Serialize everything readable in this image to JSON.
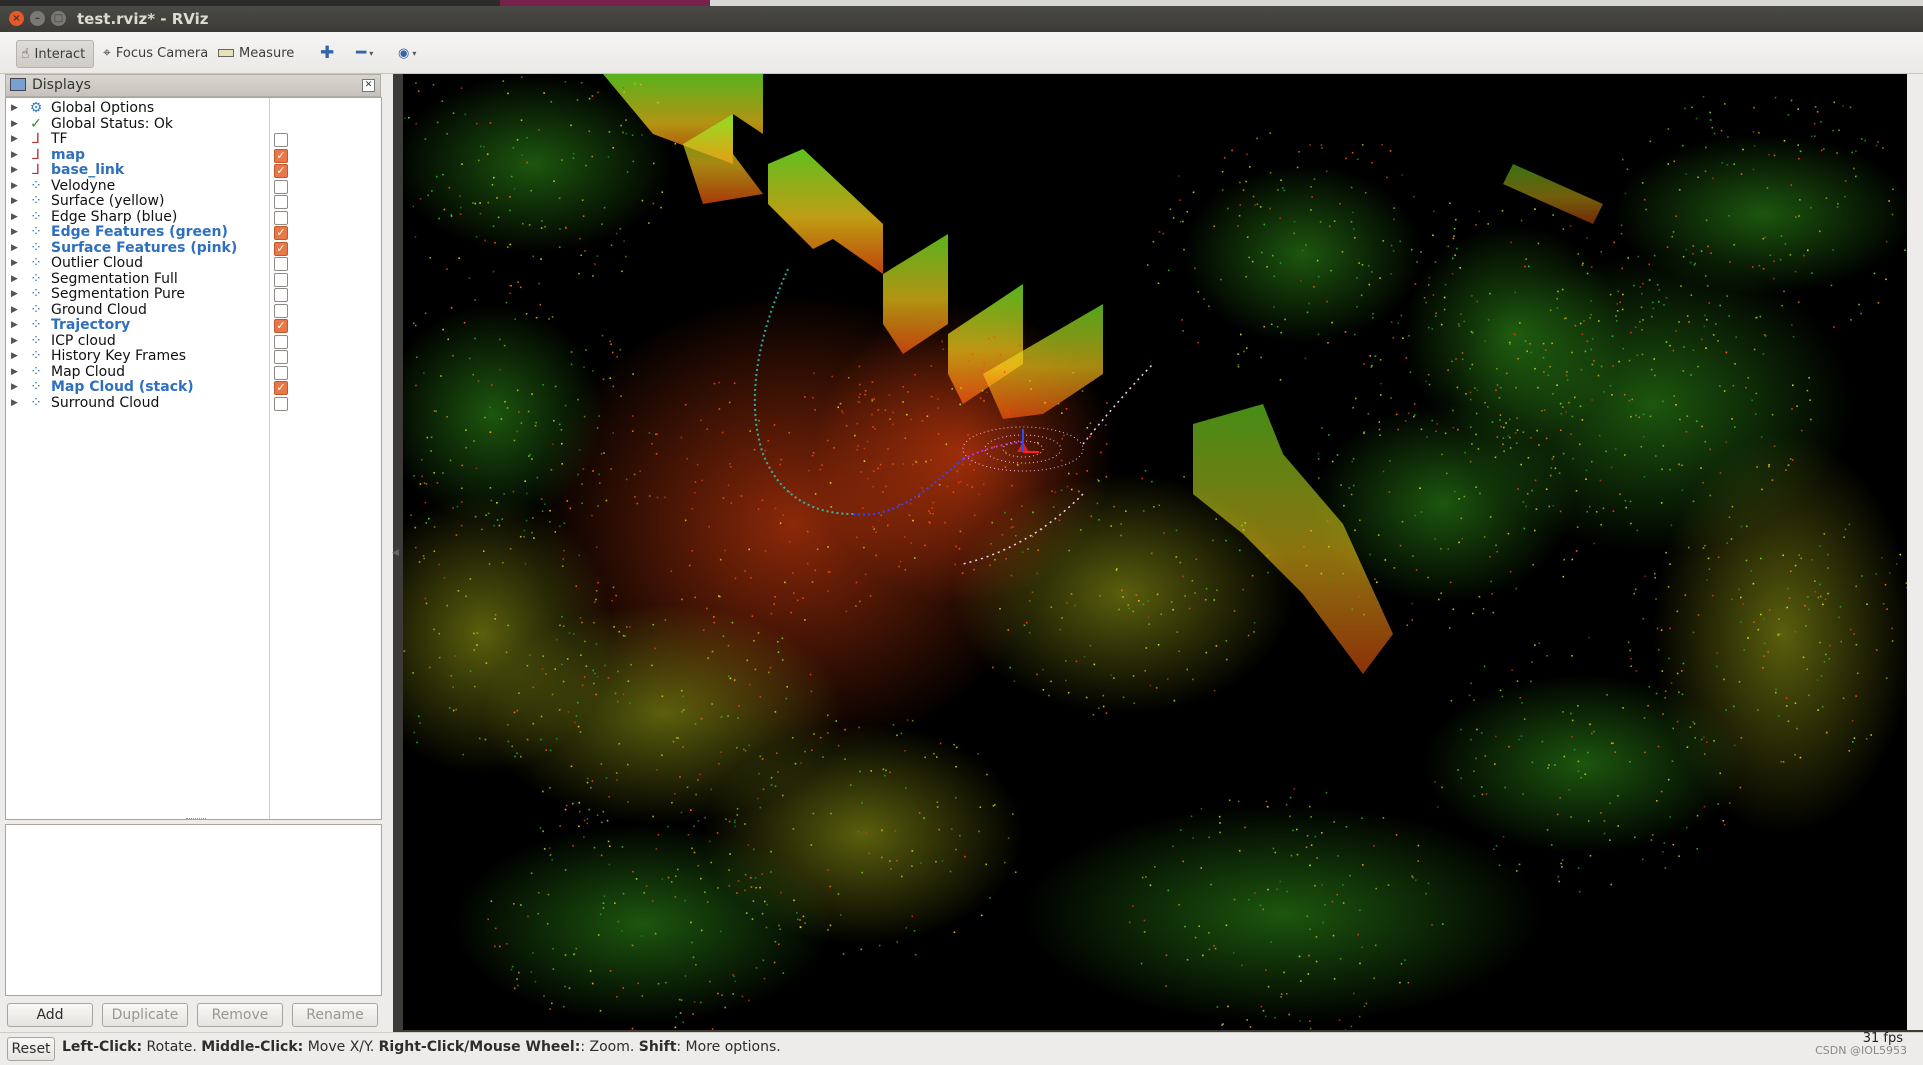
{
  "window": {
    "title": "test.rviz* - RViz",
    "close_glyph": "×",
    "min_glyph": "–",
    "max_glyph": "□"
  },
  "toolbar": {
    "interact_label": "Interact",
    "focus_label": "Focus Camera",
    "measure_label": "Measure",
    "add_glyph": "✚",
    "remove_glyph": "━",
    "view_glyph": "◉",
    "caret": "▾"
  },
  "displays": {
    "title": "Displays",
    "close_glyph": "✕",
    "expand_glyph": "▶",
    "items": [
      {
        "label": "Global Options",
        "icon": "gear-icon",
        "glyph": "⚙",
        "checkbox": null
      },
      {
        "label": "Global Status: Ok",
        "icon": "check-icon",
        "glyph": "✓",
        "checkbox": null
      },
      {
        "label": "TF",
        "icon": "axes-icon",
        "glyph": "⅃",
        "checkbox": false
      },
      {
        "label": "map",
        "icon": "axes-icon",
        "glyph": "⅃",
        "checkbox": true
      },
      {
        "label": "base_link",
        "icon": "axes-icon",
        "glyph": "⅃",
        "checkbox": true
      },
      {
        "label": "Velodyne",
        "icon": "pointcloud-icon",
        "glyph": "⁘",
        "checkbox": false
      },
      {
        "label": "Surface (yellow)",
        "icon": "pointcloud-icon",
        "glyph": "⁘",
        "checkbox": false
      },
      {
        "label": "Edge Sharp (blue)",
        "icon": "pointcloud-icon",
        "glyph": "⁘",
        "checkbox": false
      },
      {
        "label": "Edge Features (green)",
        "icon": "pointcloud-icon",
        "glyph": "⁘",
        "checkbox": true
      },
      {
        "label": "Surface Features (pink)",
        "icon": "pointcloud-icon",
        "glyph": "⁘",
        "checkbox": true
      },
      {
        "label": "Outlier Cloud",
        "icon": "pointcloud-icon",
        "glyph": "⁘",
        "checkbox": false
      },
      {
        "label": "Segmentation Full",
        "icon": "pointcloud-icon",
        "glyph": "⁘",
        "checkbox": false
      },
      {
        "label": "Segmentation Pure",
        "icon": "pointcloud-icon",
        "glyph": "⁘",
        "checkbox": false
      },
      {
        "label": "Ground Cloud",
        "icon": "pointcloud-icon",
        "glyph": "⁘",
        "checkbox": false
      },
      {
        "label": "Trajectory",
        "icon": "pointcloud-icon",
        "glyph": "⁘",
        "checkbox": true
      },
      {
        "label": "ICP cloud",
        "icon": "pointcloud-icon",
        "glyph": "⁘",
        "checkbox": false
      },
      {
        "label": "History Key Frames",
        "icon": "pointcloud-icon",
        "glyph": "⁘",
        "checkbox": false
      },
      {
        "label": "Map Cloud",
        "icon": "pointcloud-icon",
        "glyph": "⁘",
        "checkbox": false
      },
      {
        "label": "Map Cloud (stack)",
        "icon": "pointcloud-icon",
        "glyph": "⁘",
        "checkbox": true
      },
      {
        "label": "Surround Cloud",
        "icon": "pointcloud-icon",
        "glyph": "⁘",
        "checkbox": false
      }
    ],
    "checked_glyph": "✓"
  },
  "panel_buttons": {
    "add": "Add",
    "duplicate": "Duplicate",
    "remove": "Remove",
    "rename": "Rename"
  },
  "status": {
    "reset_label": "Reset",
    "left_click_key": "Left-Click:",
    "left_click_desc": " Rotate. ",
    "middle_click_key": "Middle-Click:",
    "middle_click_desc": " Move X/Y. ",
    "right_click_key": "Right-Click/Mouse Wheel:",
    "right_click_desc": ": Zoom. ",
    "shift_key": "Shift",
    "shift_desc": ": More options.",
    "fps": "31 fps",
    "watermark": "CSDN @IOL5953"
  },
  "colors": {
    "accent_checkbox": "#e87847",
    "enabled_label": "#2f6fbf",
    "viewport_background": "#000000"
  }
}
